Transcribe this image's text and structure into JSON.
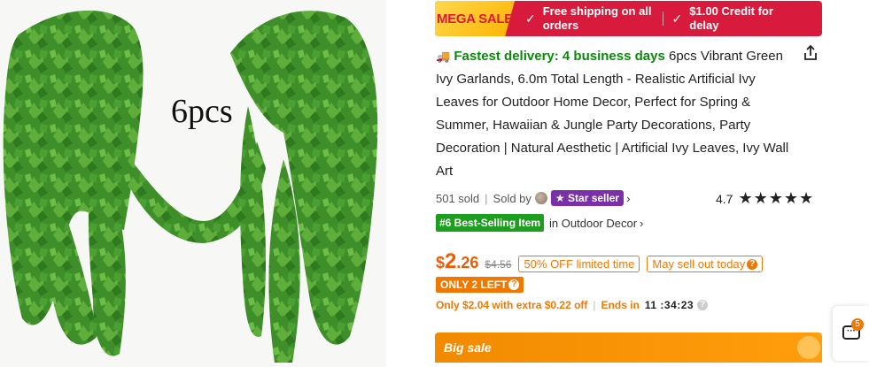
{
  "image": {
    "caption": "6pcs"
  },
  "promo": {
    "mega_sale": "MEGA SALE",
    "free_shipping_line1": "Free shipping on all",
    "free_shipping_line2": "orders",
    "credit_line1": "$1.00 Credit for",
    "credit_line2": "delay",
    "banner_color": "#d81b3c"
  },
  "title": {
    "delivery": "Fastest delivery: 4 business days",
    "text": "6pcs Vibrant Green Ivy Garlands, 6.0m Total Length - Realistic Artificial Ivy Leaves for Outdoor Home Decor, Perfect for Spring & Summer, Hawaiian & Jungle Party Decorations, Party Decoration | Natural Aesthetic | Artificial Ivy Leaves, Ivy Wall Art"
  },
  "seller": {
    "sold": "501 sold",
    "sold_by": "Sold by",
    "star_seller": "Star seller"
  },
  "rating": {
    "value": "4.7",
    "stars": 4.7
  },
  "bestseller": {
    "badge": "#6 Best-Selling Item",
    "category": "in Outdoor Decor"
  },
  "price": {
    "symbol": "$",
    "integer": "2",
    "decimal": ".26",
    "old": "$4.56",
    "discount": "50% OFF limited time",
    "sell_out": "May sell out today",
    "accent": "#f05a00"
  },
  "stock": {
    "only_left": "ONLY 2 LEFT"
  },
  "extra": {
    "text": "Only $2.04 with extra $0.22 off",
    "ends": "Ends in",
    "timer": "11 :34:23"
  },
  "big_sale": {
    "label": "Big sale"
  },
  "chat": {
    "badge": "5"
  }
}
